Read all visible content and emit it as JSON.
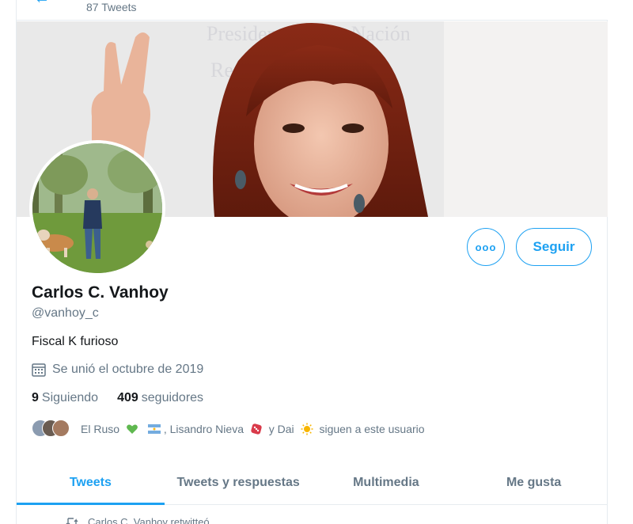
{
  "header": {
    "back_icon": "arrow-left-icon",
    "tweet_count": "87 Tweets"
  },
  "banner": {
    "background_text_1": "Presidencia de la Nación",
    "background_text_2": "República Argentina"
  },
  "actions": {
    "more_label": "ooo",
    "follow_label": "Seguir"
  },
  "profile": {
    "name": "Carlos C. Vanhoy",
    "handle": "@vanhoy_c",
    "bio": "Fiscal K furioso",
    "joined": "Se unió el octubre de 2019",
    "joined_icon": "calendar-icon",
    "following_count": "9",
    "following_label": "Siguiendo",
    "followers_count": "409",
    "followers_label": "seguidores"
  },
  "followed_by": {
    "name_1": "El Ruso",
    "name_2": ", Lisandro Nieva",
    "name_3": " y Dai",
    "suffix": " siguen a este usuario"
  },
  "tabs": [
    {
      "label": "Tweets",
      "active": true
    },
    {
      "label": "Tweets y respuestas",
      "active": false
    },
    {
      "label": "Multimedia",
      "active": false
    },
    {
      "label": "Me gusta",
      "active": false
    }
  ],
  "timeline": {
    "retweet_text": "Carlos C. Vanhoy retwitteó"
  },
  "colors": {
    "accent": "#1da1f2",
    "secondary_text": "#657786",
    "border": "#e6ecf0"
  }
}
